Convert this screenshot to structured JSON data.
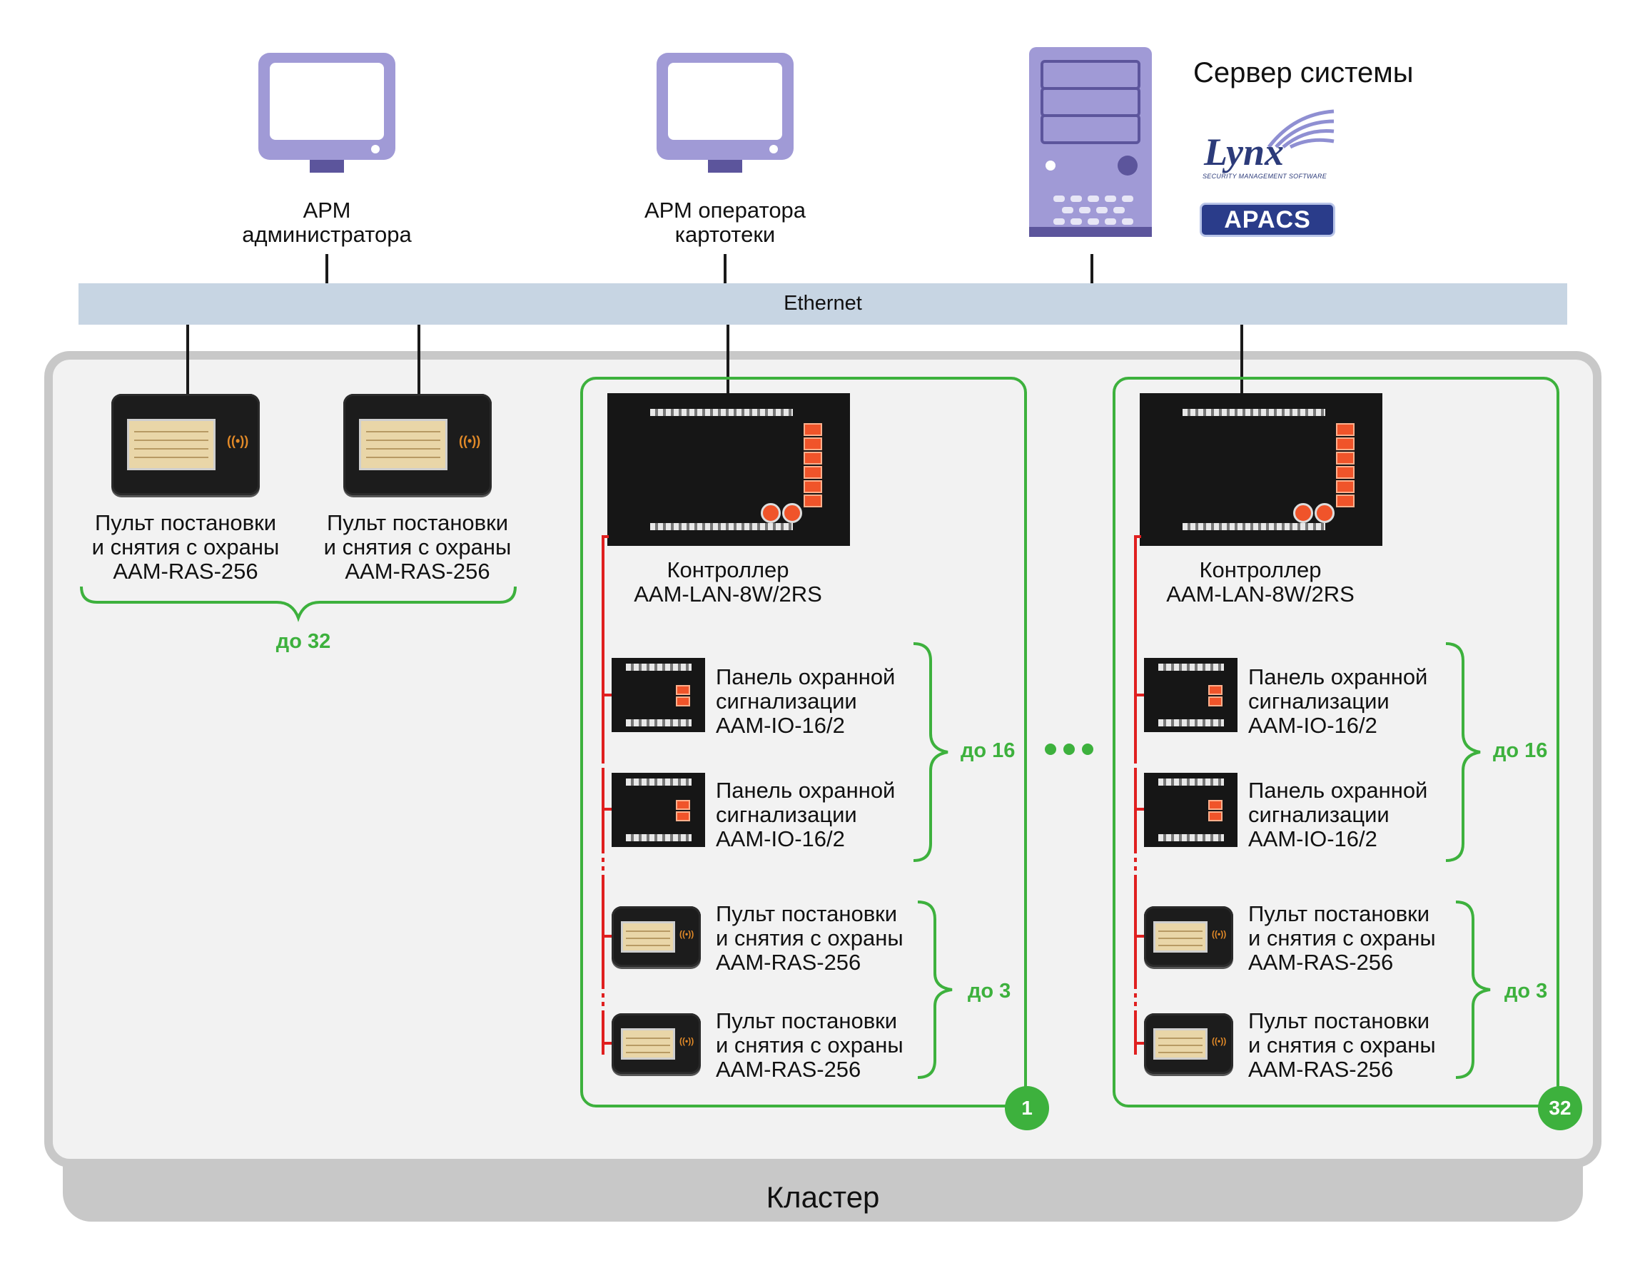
{
  "workstations": {
    "admin": {
      "label": "АРМ\nадминистратора"
    },
    "operator": {
      "label": "АРМ оператора\nкартотеки"
    }
  },
  "server": {
    "title": "Сервер системы",
    "logo_lynx": "Lynx",
    "logo_lynx_tagline": "SECURITY MANAGEMENT SOFTWARE",
    "logo_apacs": "APACS"
  },
  "network": {
    "label": "Ethernet"
  },
  "standalone_panels": {
    "label": "Пульт постановки\nи снятия с охраны\nAAM-RAS-256",
    "count": "до 32"
  },
  "clusters": [
    {
      "controller_label": "Контроллер\nAAM-LAN-8W/2RS",
      "io_label": "Панель охранной\nсигнализации\nAAM-IO-16/2",
      "io_count": "до 16",
      "ras_label": "Пульт постановки\nи снятия с охраны\nAAM-RAS-256",
      "ras_count": "до 3",
      "number": "1"
    },
    {
      "controller_label": "Контроллер\nAAM-LAN-8W/2RS",
      "io_label": "Панель охранной\nсигнализации\nAAM-IO-16/2",
      "io_count": "до 16",
      "ras_label": "Пульт постановки\nи снятия с охраны\nAAM-RAS-256",
      "ras_count": "до 3",
      "number": "32"
    }
  ],
  "cluster_label": "Кластер",
  "colors": {
    "accent_green": "#3db13d",
    "bus_red": "#e02020",
    "network": "#c7d5e3",
    "device_purple": "#a09ad6",
    "cluster_gray": "#c8c8c8"
  },
  "icons": [
    "monitor-icon",
    "server-tower-icon",
    "ellipsis-icon"
  ]
}
